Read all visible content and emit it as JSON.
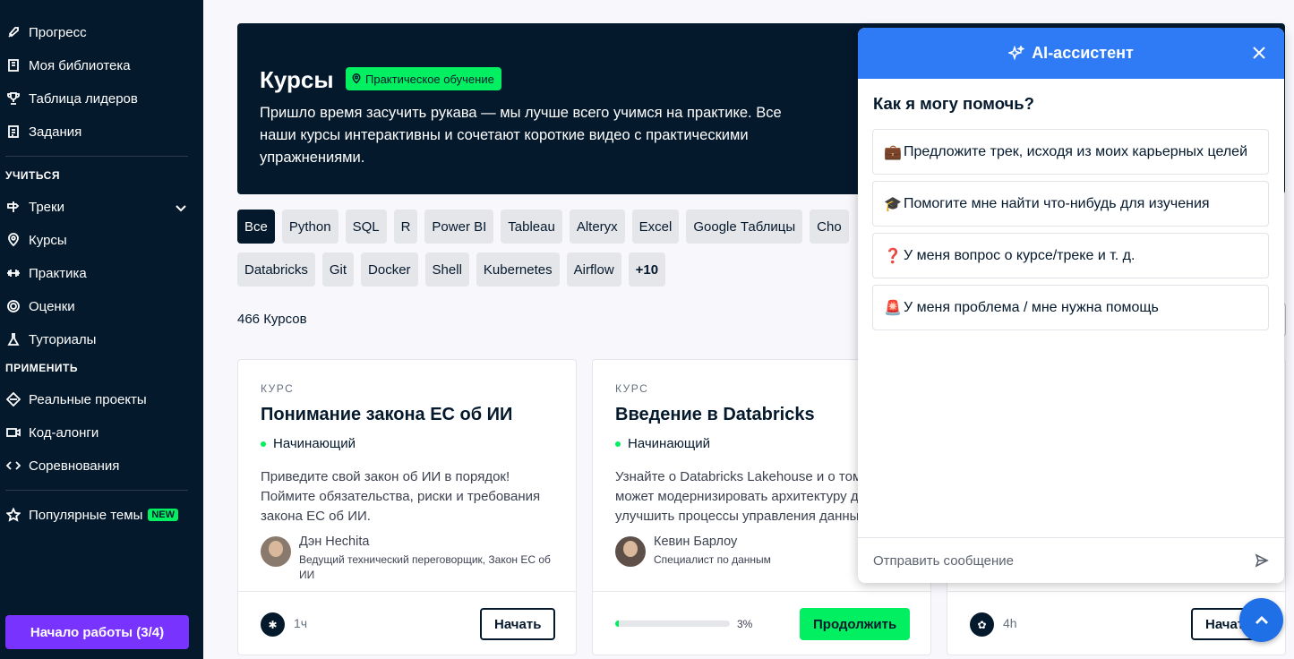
{
  "sidebar": {
    "top_items": [
      {
        "label": "Прогресс",
        "icon": "rocket-icon"
      },
      {
        "label": "Моя библиотека",
        "icon": "bookmark-icon"
      },
      {
        "label": "Таблица лидеров",
        "icon": "trophy-icon"
      },
      {
        "label": "Задания",
        "icon": "clipboard-icon"
      }
    ],
    "learn_label": "УЧИТЬСЯ",
    "learn_items": [
      {
        "label": "Треки",
        "icon": "tracks-icon"
      },
      {
        "label": "Курсы",
        "icon": "location-icon"
      },
      {
        "label": "Практика",
        "icon": "dumbbell-icon"
      },
      {
        "label": "Оценки",
        "icon": "assessment-icon"
      },
      {
        "label": "Туториалы",
        "icon": "flask-icon"
      }
    ],
    "apply_label": "ПРИМЕНИТЬ",
    "apply_items": [
      {
        "label": "Реальные проекты",
        "icon": "diamond-icon"
      },
      {
        "label": "Код-алонги",
        "icon": "video-icon"
      },
      {
        "label": "Соревнования",
        "icon": "code-icon"
      }
    ],
    "popular_label": "Популярные темы",
    "new_badge": "NEW",
    "start_button": "Начало работы (3/4)"
  },
  "hero": {
    "title": "Курсы",
    "badge": "Практическое обучение",
    "description": "Пришло время засучить рукава — мы лучше всего учимся на практике. Все наши курсы интерактивны и сочетают короткие видео с практическими упражнениями."
  },
  "filters": {
    "row1": [
      "Все",
      "Python",
      "SQL",
      "R",
      "Power BI",
      "Tableau",
      "Alteryx",
      "Excel",
      "Google Таблицы",
      "Cho"
    ],
    "row2": [
      "Databricks",
      "Git",
      "Docker",
      "Shell",
      "Kubernetes",
      "Airflow",
      "+10"
    ],
    "active": "Все"
  },
  "results_count": "466 Курсов",
  "cards": [
    {
      "kicker": "КУРС",
      "title": "Понимание закона ЕС об ИИ",
      "level": "Начинающий",
      "desc_lines": [
        "Приведите свой закон об ИИ в порядок!",
        "Поймите обязательства, риски и требования",
        "закона ЕС об ИИ."
      ],
      "author_name": "Дэн Hechita",
      "author_role": "Ведущий технический переговорщик, Закон ЕС об ИИ",
      "duration": "1ч",
      "button": "Начать"
    },
    {
      "kicker": "КУРС",
      "title": "Введение в Databricks",
      "level": "Начинающий",
      "desc_lines": [
        "Узнайте о Databricks Lakehouse и о том, как",
        "может модернизировать архитектуру данных и",
        "улучшить процессы управления данными."
      ],
      "author_name": "Кевин Барлоу",
      "author_role": "Специалист по данным",
      "progress_label": "3%",
      "progress": 0.03,
      "button": "Продолжить"
    },
    {
      "duration": "4h",
      "button": "Начать"
    }
  ],
  "ai": {
    "title": "AI-ассистент",
    "question": "Как я могу помочь?",
    "options": [
      {
        "emoji": "💼",
        "text": "Предложите трек, исходя из моих карьерных целей"
      },
      {
        "emoji": "🎓",
        "text": "Помогите мне найти что-нибудь для изучения"
      },
      {
        "emoji": "❓",
        "text": "У меня вопрос о курсе/треке и т. д."
      },
      {
        "emoji": "🚨",
        "text": "У меня проблема / мне нужна помощь"
      }
    ],
    "input_placeholder": "Отправить сообщение"
  },
  "colors": {
    "navy": "#05192d",
    "green": "#03ef62",
    "purple": "#7933ff",
    "blue": "#2f7bf5"
  }
}
